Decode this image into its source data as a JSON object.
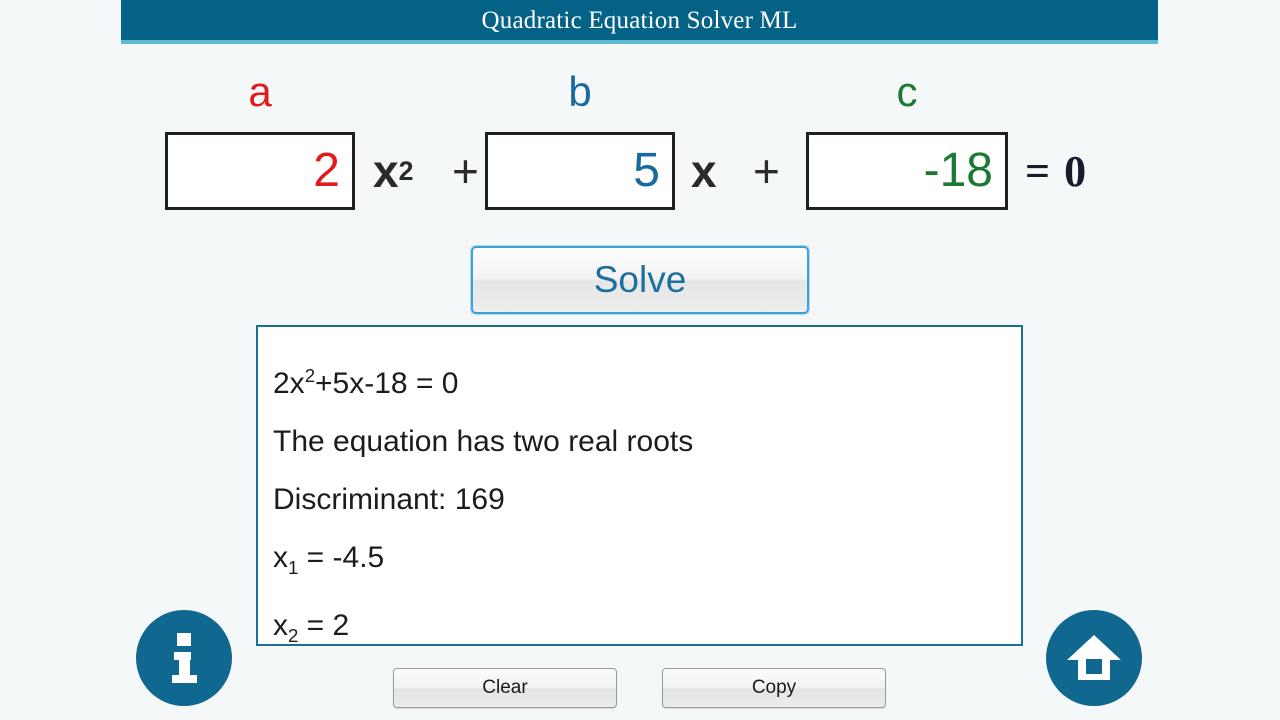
{
  "app": {
    "title": "Quadratic Equation Solver ML",
    "accent_color": "#046287",
    "accent_underline_color": "#5fb8d4",
    "page_background": "#f4f8f9"
  },
  "equation": {
    "coefficients": [
      {
        "label": "a",
        "value": "2",
        "color": "#e01b1b",
        "name": "coefficient-a"
      },
      {
        "label": "b",
        "value": "5",
        "color": "#17699f",
        "name": "coefficient-b"
      },
      {
        "label": "c",
        "value": "-18",
        "color": "#1a7a34",
        "name": "coefficient-c"
      }
    ],
    "operators": {
      "x_squared": "x",
      "x_squared_exp": "2",
      "plus_1": "+",
      "x_term": "x",
      "plus_2": "+",
      "equals": "=",
      "zero": "0"
    }
  },
  "solve": {
    "label": "Solve"
  },
  "results": {
    "border_color": "#1c6f94",
    "lines": [
      {
        "name": "equation-echo",
        "prefix": "2x",
        "sup": "2",
        "suffix": "+5x-18 = 0"
      },
      {
        "name": "root-type",
        "text": "The equation has two real roots"
      },
      {
        "name": "discriminant",
        "text": "Discriminant: 169"
      },
      {
        "name": "root-x1",
        "prefix": "x",
        "sub": "1",
        "suffix": " = -4.5"
      },
      {
        "name": "root-x2",
        "prefix": "x",
        "sub": "2",
        "suffix": " = 2"
      }
    ]
  },
  "actions": {
    "clear_label": "Clear",
    "copy_label": "Copy",
    "info_icon": "info-icon",
    "home_icon": "home-icon",
    "icon_circle_color": "#10678f"
  }
}
